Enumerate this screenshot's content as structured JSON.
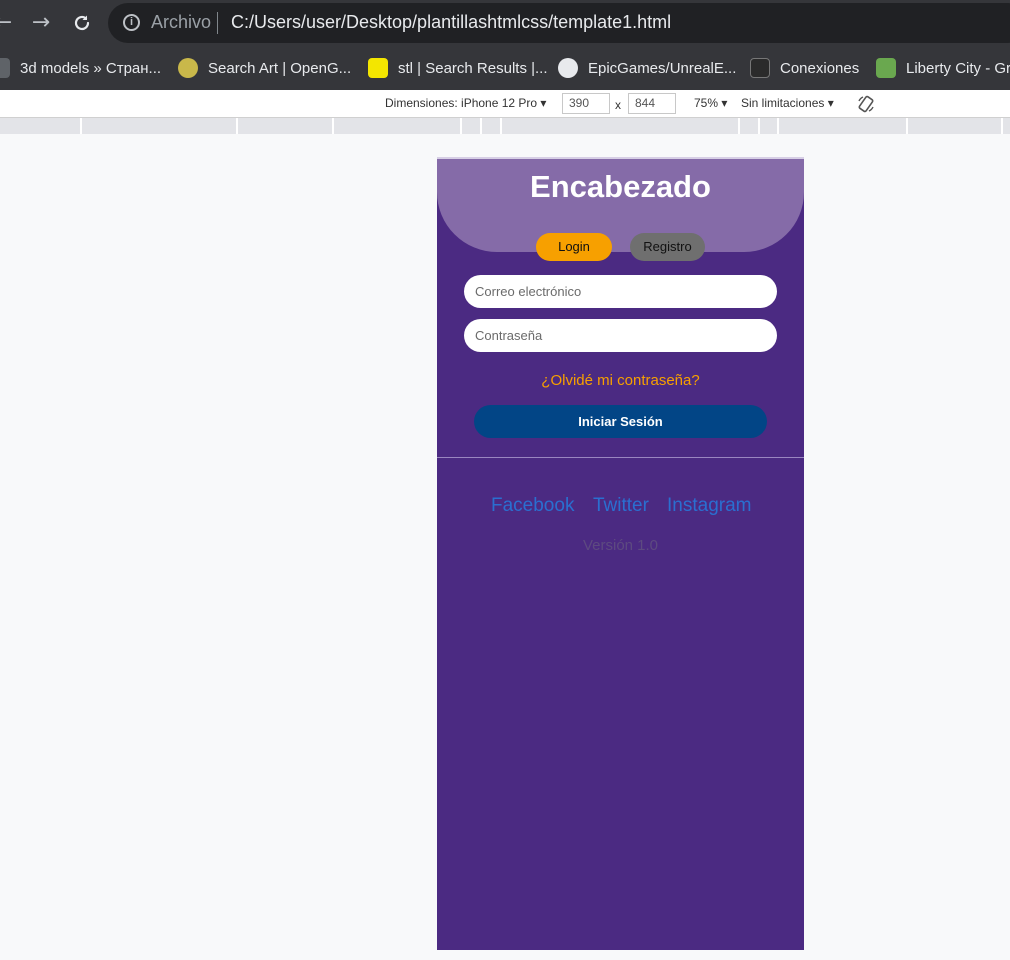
{
  "browser": {
    "scheme_label": "Archivo",
    "url": "C:/Users/user/Desktop/plantillashtmlcss/template1.html",
    "bookmarks": [
      {
        "label": "3d models » Стран...",
        "icon": "bookmark-3dmodels-icon"
      },
      {
        "label": "Search Art | OpenG...",
        "icon": "opengameart-icon"
      },
      {
        "label": "stl | Search Results |...",
        "icon": "stl-search-icon"
      },
      {
        "label": "EpicGames/UnrealE...",
        "icon": "github-icon"
      },
      {
        "label": "Conexiones",
        "icon": "epic-games-icon"
      },
      {
        "label": "Liberty City - Gr",
        "icon": "liberty-city-icon"
      }
    ]
  },
  "devtools": {
    "dimensions_label": "Dimensiones: iPhone 12 Pro",
    "width_value": "390",
    "times_sign": "x",
    "height_value": "844",
    "zoom_label": "75%",
    "throttle_label": "Sin limitaciones"
  },
  "page": {
    "header_title": "Encabezado",
    "tabs": {
      "login": "Login",
      "register": "Registro"
    },
    "email_placeholder": "Correo electrónico",
    "password_placeholder": "Contraseña",
    "forgot_link": "¿Olvidé mi contraseña?",
    "submit_label": "Iniciar Sesión",
    "social": {
      "facebook": "Facebook",
      "twitter": "Twitter",
      "instagram": "Instagram"
    },
    "version": "Versión 1.0"
  },
  "colors": {
    "header": "#856ba8",
    "body": "#4b2a82",
    "accent": "#f7a000",
    "tab_inactive": "#6f6f6f",
    "submit": "#024586",
    "link": "#2a6fd0"
  }
}
